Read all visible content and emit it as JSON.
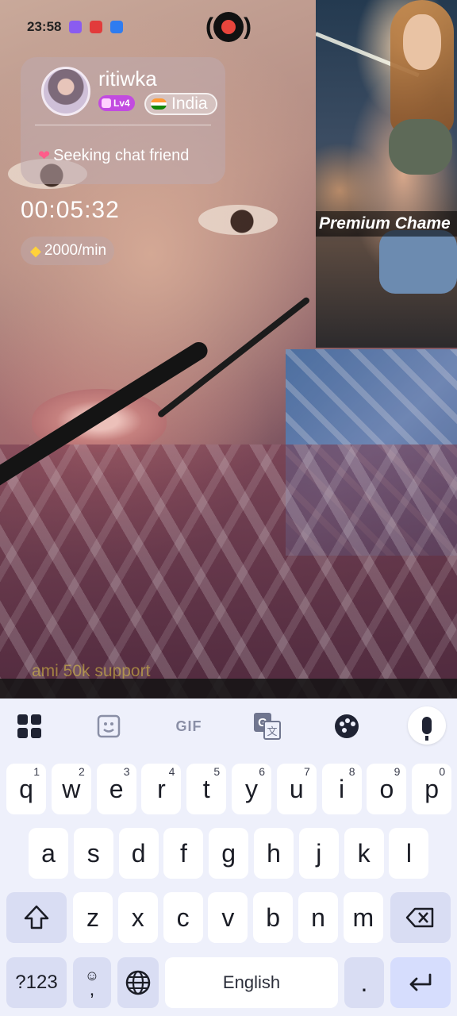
{
  "status_bar": {
    "time": "23:58",
    "icons": [
      "purple-app-icon",
      "youtube-icon",
      "blue-app-icon"
    ]
  },
  "recording": {
    "icon": "record-icon"
  },
  "profile": {
    "username": "ritiwka",
    "level": "Lv4",
    "country": "India",
    "status_text": "Seeking chat friend"
  },
  "call": {
    "timer": "00:05:32",
    "rate": "2000/min"
  },
  "ad": {
    "label": "Premium Chame"
  },
  "comment": {
    "text": "ami 50k support"
  },
  "keyboard": {
    "toolbar": {
      "gif_label": "GIF"
    },
    "row1": [
      {
        "label": "q",
        "hint": "1"
      },
      {
        "label": "w",
        "hint": "2"
      },
      {
        "label": "e",
        "hint": "3"
      },
      {
        "label": "r",
        "hint": "4"
      },
      {
        "label": "t",
        "hint": "5"
      },
      {
        "label": "y",
        "hint": "6"
      },
      {
        "label": "u",
        "hint": "7"
      },
      {
        "label": "i",
        "hint": "8"
      },
      {
        "label": "o",
        "hint": "9"
      },
      {
        "label": "p",
        "hint": "0"
      }
    ],
    "row2": [
      "a",
      "s",
      "d",
      "f",
      "g",
      "h",
      "j",
      "k",
      "l"
    ],
    "row3": [
      "z",
      "x",
      "c",
      "v",
      "b",
      "n",
      "m"
    ],
    "symbols_label": "?123",
    "emoji_comma": ",",
    "space_label": "English",
    "period_label": "."
  },
  "colors": {
    "record": "#e8453c",
    "level_badge": "#c24be0",
    "keyboard_bg": "#eef0fb"
  }
}
